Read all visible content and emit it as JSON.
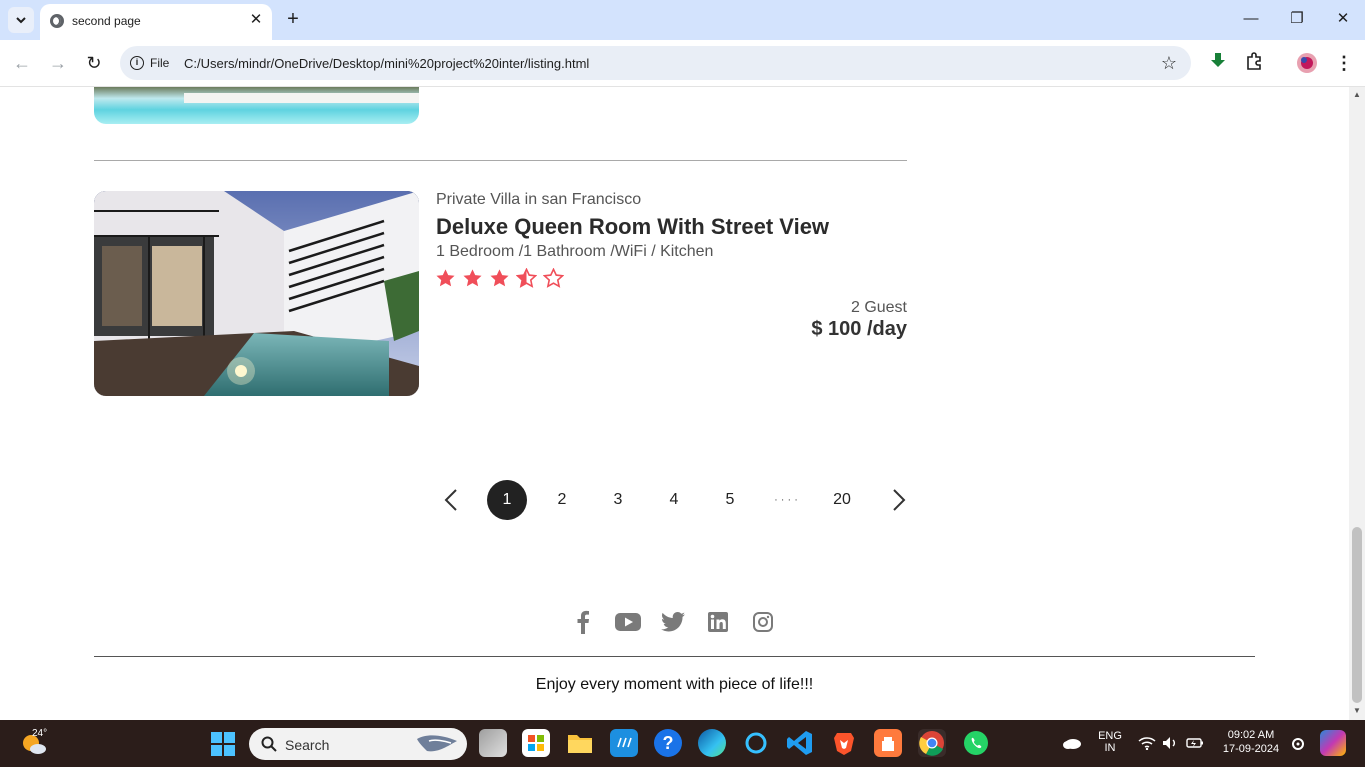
{
  "browser": {
    "tab_title": "second page",
    "address_chip": "File",
    "url": "C:/Users/mindr/OneDrive/Desktop/mini%20project%20inter/listing.html"
  },
  "listing": {
    "location": "Private Villa in san Francisco",
    "title": "Deluxe Queen Room With Street View",
    "features": "1 Bedroom /1 Bathroom /WiFi / Kitchen",
    "rating": 3.5,
    "rating_max": 5,
    "guests": "2 Guest",
    "price": "$ 100 /day"
  },
  "pagination": {
    "pages": [
      "1",
      "2",
      "3",
      "4",
      "5",
      "20"
    ],
    "ellipsis": "· · · ·",
    "active": "1"
  },
  "footer": {
    "social": [
      "facebook-icon",
      "youtube-icon",
      "twitter-icon",
      "linkedin-icon",
      "instagram-icon"
    ],
    "tagline": "Enjoy every moment with piece of life!!!"
  },
  "taskbar": {
    "temperature": "24°",
    "search_placeholder": "Search",
    "lang_line1": "ENG",
    "lang_line2": "IN",
    "time": "09:02 AM",
    "date": "17-09-2024"
  },
  "colors": {
    "star": "#f04e59",
    "tabbar": "#d3e3fd",
    "taskbar": "#2b1d1a"
  }
}
